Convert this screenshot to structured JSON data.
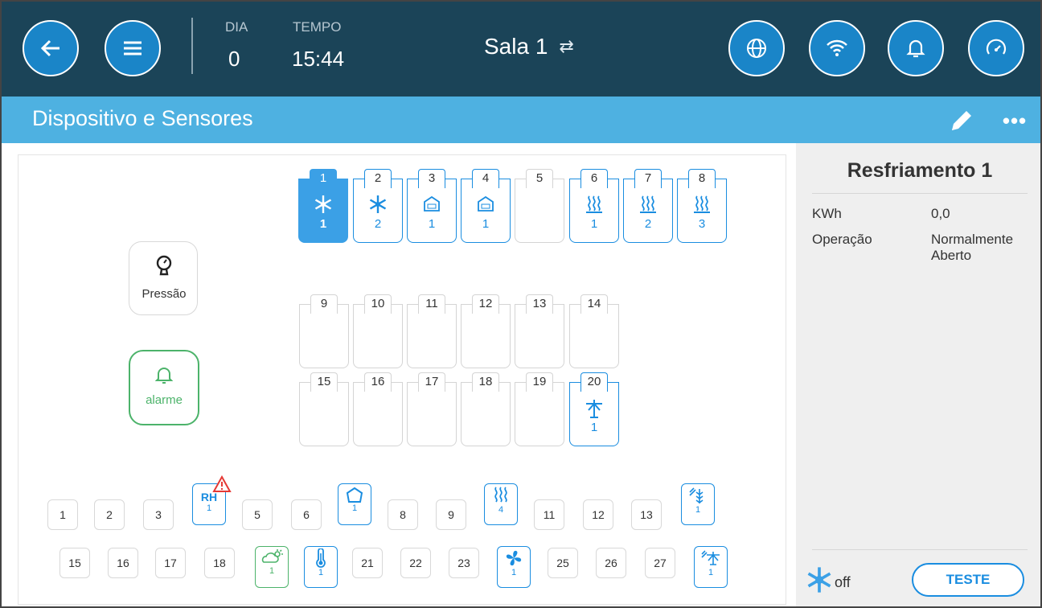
{
  "header": {
    "day_label": "DIA",
    "day_value": "0",
    "time_label": "TEMPO",
    "time_value": "15:44",
    "room": "Sala 1",
    "room_swap": "⇄"
  },
  "title_bar": {
    "title": "Dispositivo e Sensores",
    "more": "•••"
  },
  "devices": {
    "row1": [
      {
        "num": "1",
        "icon": "snowflake-icon",
        "sub": "1",
        "state": "on"
      },
      {
        "num": "2",
        "icon": "snowflake-icon",
        "sub": "2",
        "state": "assigned"
      },
      {
        "num": "3",
        "icon": "house-op-icon",
        "sub": "1",
        "state": "assigned"
      },
      {
        "num": "4",
        "icon": "house-cl-icon",
        "sub": "1",
        "state": "assigned"
      },
      {
        "num": "5",
        "icon": "",
        "sub": "",
        "state": "empty"
      },
      {
        "num": "6",
        "icon": "heater-icon",
        "sub": "1",
        "state": "assigned"
      },
      {
        "num": "7",
        "icon": "heater-icon",
        "sub": "2",
        "state": "assigned"
      },
      {
        "num": "8",
        "icon": "heater-icon",
        "sub": "3",
        "state": "assigned"
      }
    ],
    "row2": [
      {
        "num": "9"
      },
      {
        "num": "10"
      },
      {
        "num": "11"
      },
      {
        "num": "12"
      },
      {
        "num": "13"
      },
      {
        "num": "14"
      }
    ],
    "row3": [
      {
        "num": "15"
      },
      {
        "num": "16"
      },
      {
        "num": "17"
      },
      {
        "num": "18"
      },
      {
        "num": "19"
      },
      {
        "num": "20",
        "icon": "sprinkler-icon",
        "sub": "1",
        "state": "assigned"
      }
    ]
  },
  "pressure": {
    "label": "Pressão"
  },
  "alarm": {
    "label": "alarme"
  },
  "sensors_row1": [
    "1",
    "2",
    "3",
    "RH",
    "5",
    "6",
    "",
    "8",
    "9",
    "",
    "11",
    "12",
    "13",
    ""
  ],
  "sensors_row1_subs": {
    "rh": "1",
    "house": "1",
    "heater": "4",
    "fogger": "1"
  },
  "sensors_row2": [
    "15",
    "16",
    "17",
    "18",
    "",
    "",
    "21",
    "22",
    "23",
    "",
    "25",
    "26",
    "27",
    ""
  ],
  "sensors_row2_subs": {
    "weather": "1",
    "thermo": "1",
    "fan": "1",
    "sprinkler": "1"
  },
  "side": {
    "title": "Resfriamento 1",
    "kwh_label": "KWh",
    "kwh_value": "0,0",
    "op_label": "Operação",
    "op_value": "Normalmente Aberto",
    "status": "off",
    "test_button": "TESTE"
  },
  "colors": {
    "header": "#1b4458",
    "titlebar": "#4eb1e1",
    "accent": "#1a8de0",
    "green": "#4cb36a",
    "alert": "#e53935"
  }
}
